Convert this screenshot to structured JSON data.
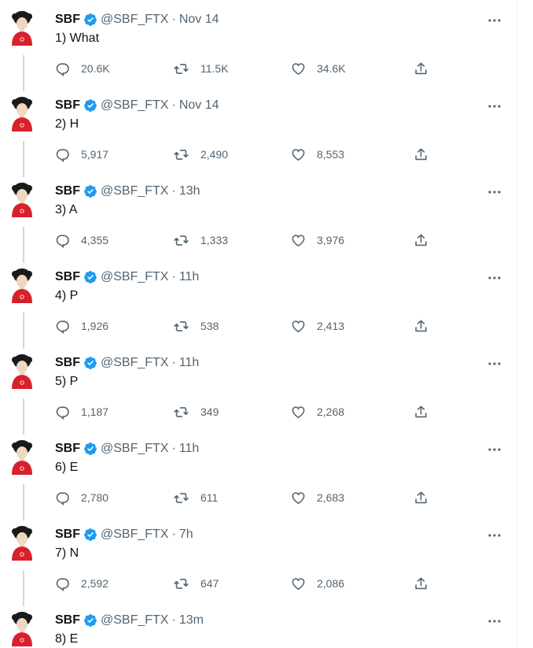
{
  "colors": {
    "verified": "#1d9bf0",
    "muted": "#536471",
    "thread_line": "#cfd9de",
    "avatar_shirt": "#d8202b"
  },
  "icons": {
    "reply": "reply-icon",
    "retweet": "retweet-icon",
    "like": "heart-icon",
    "share": "share-icon",
    "more": "more-icon",
    "verified": "verified-badge-icon"
  },
  "tweets": [
    {
      "name": "SBF",
      "handle": "@SBF_FTX",
      "dot": "·",
      "time": "Nov 14",
      "text": "1) What",
      "replies": "20.6K",
      "retweets": "11.5K",
      "likes": "34.6K"
    },
    {
      "name": "SBF",
      "handle": "@SBF_FTX",
      "dot": "·",
      "time": "Nov 14",
      "text": "2) H",
      "replies": "5,917",
      "retweets": "2,490",
      "likes": "8,553"
    },
    {
      "name": "SBF",
      "handle": "@SBF_FTX",
      "dot": "·",
      "time": "13h",
      "text": "3) A",
      "replies": "4,355",
      "retweets": "1,333",
      "likes": "3,976"
    },
    {
      "name": "SBF",
      "handle": "@SBF_FTX",
      "dot": "·",
      "time": "11h",
      "text": "4) P",
      "replies": "1,926",
      "retweets": "538",
      "likes": "2,413"
    },
    {
      "name": "SBF",
      "handle": "@SBF_FTX",
      "dot": "·",
      "time": "11h",
      "text": "5) P",
      "replies": "1,187",
      "retweets": "349",
      "likes": "2,268"
    },
    {
      "name": "SBF",
      "handle": "@SBF_FTX",
      "dot": "·",
      "time": "11h",
      "text": "6) E",
      "replies": "2,780",
      "retweets": "611",
      "likes": "2,683"
    },
    {
      "name": "SBF",
      "handle": "@SBF_FTX",
      "dot": "·",
      "time": "7h",
      "text": "7) N",
      "replies": "2,592",
      "retweets": "647",
      "likes": "2,086"
    },
    {
      "name": "SBF",
      "handle": "@SBF_FTX",
      "dot": "·",
      "time": "13m",
      "text": "8) E"
    }
  ]
}
